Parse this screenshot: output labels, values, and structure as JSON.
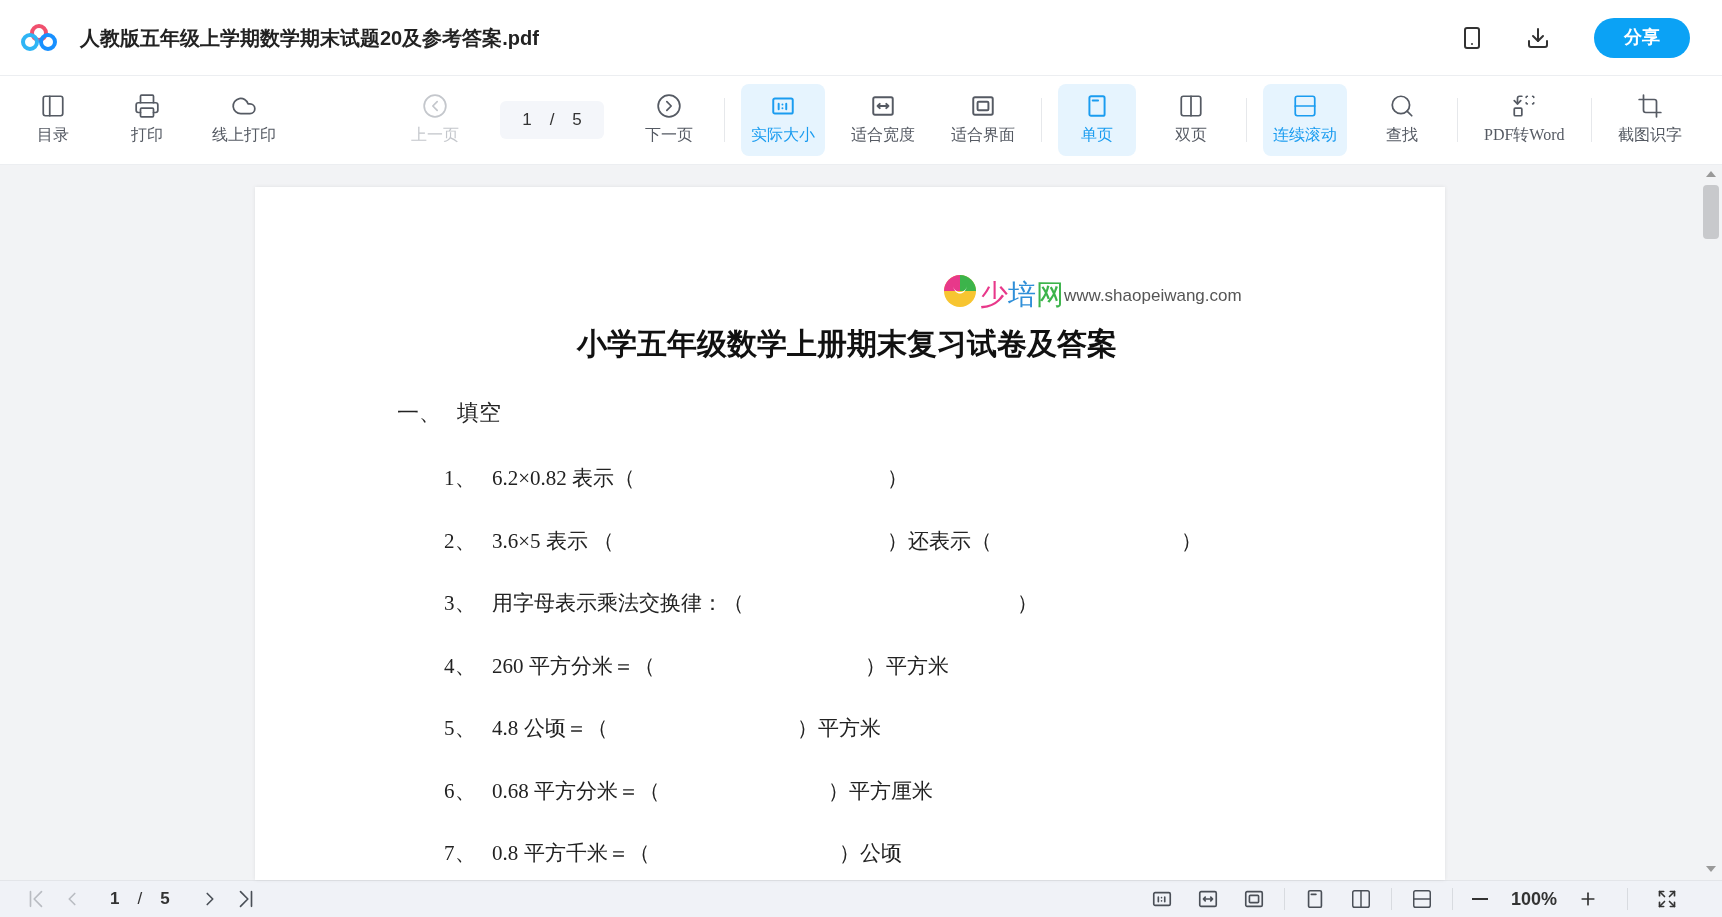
{
  "header": {
    "title": "人教版五年级上学期数学期末试题20及参考答案.pdf",
    "share": "分享"
  },
  "toolbar": {
    "groups": [
      [
        {
          "kind": "toc",
          "label": "目录",
          "selected": false,
          "disabled": false
        },
        {
          "kind": "print",
          "label": "打印",
          "selected": false,
          "disabled": false
        },
        {
          "kind": "cloudprint",
          "label": "线上打印",
          "selected": false,
          "disabled": false
        }
      ],
      [
        {
          "kind": "prev",
          "label": "上一页",
          "selected": false,
          "disabled": true
        },
        {
          "kind": "pager",
          "page": "1",
          "separator": "/",
          "total": "5"
        },
        {
          "kind": "next",
          "label": "下一页",
          "selected": false,
          "disabled": false
        }
      ],
      [
        {
          "kind": "actual",
          "label": "实际大小",
          "selected": true,
          "disabled": false
        },
        {
          "kind": "fitwidth",
          "label": "适合宽度",
          "selected": false,
          "disabled": false
        },
        {
          "kind": "fitpage",
          "label": "适合界面",
          "selected": false,
          "disabled": false
        }
      ],
      [
        {
          "kind": "single",
          "label": "单页",
          "selected": true,
          "disabled": false
        },
        {
          "kind": "double",
          "label": "双页",
          "selected": false,
          "disabled": false
        }
      ],
      [
        {
          "kind": "continuous",
          "label": "连续滚动",
          "selected": true,
          "disabled": false
        },
        {
          "kind": "find",
          "label": "查找",
          "selected": false,
          "disabled": false
        }
      ],
      [
        {
          "kind": "convert",
          "label": "PDF转Word",
          "selected": false,
          "disabled": false
        }
      ],
      [
        {
          "kind": "ocr",
          "label": "截图识字",
          "selected": false,
          "disabled": false
        }
      ]
    ]
  },
  "document": {
    "brand": [
      {
        "char": "少",
        "color": "#e8388a"
      },
      {
        "char": "培",
        "color": "#2f8fd8"
      },
      {
        "char": "网",
        "color": "#3cb44b"
      }
    ],
    "url": "www.shaopeiwang.com",
    "title": "小学五年级数学上册期末复习试卷及答案",
    "section": {
      "number": "一、",
      "title": "填空"
    },
    "questions": [
      {
        "number": "1、",
        "text": "6.2×0.82 表示（　　　　　　　　　　　　）"
      },
      {
        "number": "2、",
        "text": "3.6×5 表示 （　　　　　　　　　　　　　）还表示（　　　　　　　　　）"
      },
      {
        "number": "3、",
        "text": "用字母表示乘法交换律：（　　　　　　　　　　　　　）"
      },
      {
        "number": "4、",
        "text": "260 平方分米＝（　　　　　　　　　　）平方米"
      },
      {
        "number": "5、",
        "text": "4.8 公顷＝（　　　　　　　　　）平方米"
      },
      {
        "number": "6、",
        "text": "0.68 平方分米＝（　　　　　　　　）平方厘米"
      },
      {
        "number": "7、",
        "text": "0.8 平方千米＝（　　　　　　　　　）公顷"
      }
    ]
  },
  "bottom_bar": {
    "nav": [
      {
        "kind": "first",
        "disabled": true
      },
      {
        "kind": "prev",
        "disabled": true
      }
    ],
    "page": "1",
    "separator": "/",
    "total": "5",
    "nav_after": [
      {
        "kind": "next",
        "disabled": false
      },
      {
        "kind": "last",
        "disabled": false
      }
    ],
    "views": [
      [
        {
          "kind": "actual"
        },
        {
          "kind": "fitwidth"
        },
        {
          "kind": "fitpage"
        }
      ],
      [
        {
          "kind": "single"
        },
        {
          "kind": "double"
        }
      ],
      [
        {
          "kind": "continuous"
        }
      ]
    ],
    "zoom": "100%"
  }
}
